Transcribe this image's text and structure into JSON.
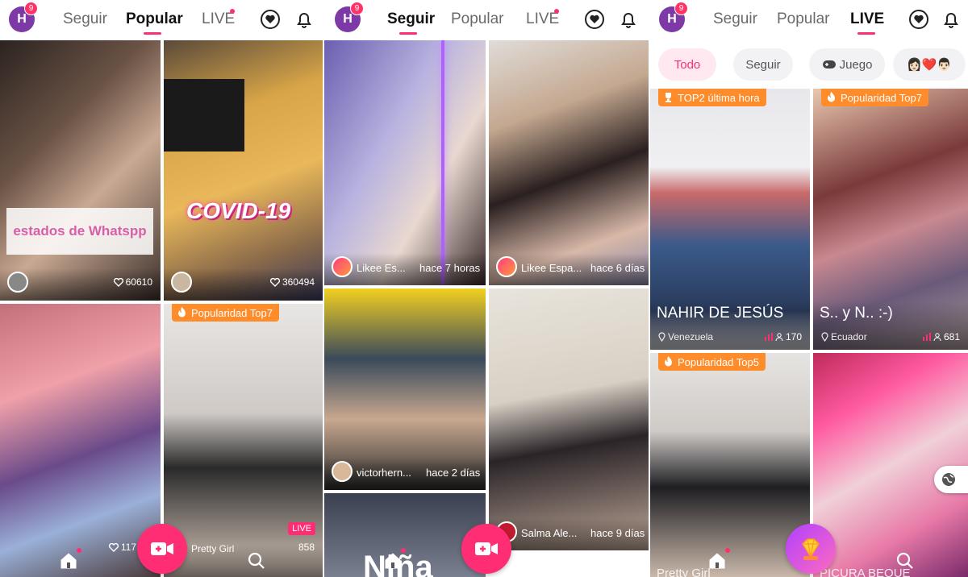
{
  "header": {
    "avatar_letter": "H",
    "notif_count": "9"
  },
  "tabs": {
    "seguir": "Seguir",
    "popular": "Popular",
    "live": "LIVE"
  },
  "panel1": {
    "tiles": [
      {
        "overlay": "estados de Whatspp",
        "likes": "60610"
      },
      {
        "overlay": "COVID-19",
        "likes": "360494"
      },
      {
        "likes": "117"
      },
      {
        "badge": "Popularidad Top7",
        "live": "LIVE",
        "user": "Pretty Girl",
        "viewers": "858"
      }
    ]
  },
  "panel2": {
    "tiles": [
      {
        "user": "Likee Es...",
        "time": "hace 7 horas"
      },
      {
        "user": "Likee Espa...",
        "time": "hace 6 días"
      },
      {
        "user": "victorhern...",
        "time": "hace 2 días"
      },
      {
        "user": "Salma Ale...",
        "time": "hace 9 días"
      },
      {
        "overlay": "Niña"
      }
    ]
  },
  "panel3": {
    "chips": [
      "Todo",
      "Seguir",
      "Juego",
      "👩🏻❤️👨🏻"
    ],
    "tiles": [
      {
        "badge": "TOP2 última hora",
        "name": "NAHIR DE JESÚS",
        "location": "Venezuela",
        "viewers": "170"
      },
      {
        "badge": "Popularidad Top7",
        "name": "S.. y N.. :-)",
        "location": "Ecuador",
        "viewers": "681"
      },
      {
        "badge": "Popularidad Top5",
        "name": "Pretty Girl"
      },
      {
        "name": "PICURA BEQUE"
      }
    ]
  },
  "colors": {
    "accent": "#ff2e74",
    "badge_orange": "#ff8c2a",
    "avatar": "#7d3aa6"
  }
}
